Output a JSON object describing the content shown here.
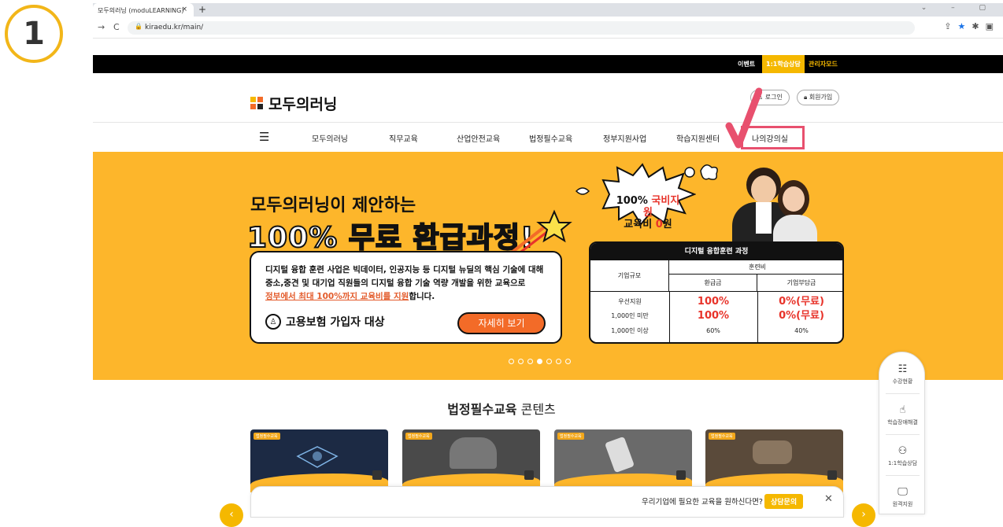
{
  "step_number": "1",
  "browser": {
    "tab_title": "모두의러닝 (moduLEARNING)",
    "tab_close": "×",
    "new_tab": "+",
    "url": "kiraedu.kr/main/",
    "window_controls": "⌄ – ▢",
    "back": "→",
    "reload": "C"
  },
  "topbar": {
    "event": "이벤트",
    "consult": "1:1학습상담",
    "admin": "관리자모드"
  },
  "header": {
    "logo_text": "모두의러닝",
    "login": "로그인",
    "signup": "회원가입"
  },
  "nav": {
    "items": [
      "모두의러닝",
      "직무교육",
      "산업안전교육",
      "법정필수교육",
      "정부지원사업",
      "학습지원센터",
      "나의강의실"
    ]
  },
  "banner": {
    "title1": "모두의러닝이 제안하는",
    "title2": "100% 무료 환급과정!",
    "desc_line1": "디지털 융합 훈련 사업은 빅데이터, 인공지능 등 디지털 뉴딜의 핵심 기술에 대해",
    "desc_line2": "중소,중견 및 대기업 직원들의 디지털 융합 기술 역량 개발을 위한 교육으로",
    "desc_hl": "정부에서 최대 100%까지 교육비를 지원",
    "desc_tail": "합니다.",
    "target": "고용보험 가입자 대상",
    "button": "자세히 보기",
    "burst_line1a": "100% ",
    "burst_line1b": "국비지원",
    "burst_line2a": "교육비 ",
    "burst_line2b": "0",
    "burst_line2c": "원",
    "table": {
      "title": "디지털 융합훈련 과정",
      "col_company": "기업규모",
      "col_fee": "훈련비",
      "col_refund": "환급금",
      "col_burden": "기업부담금",
      "rows": [
        {
          "size": "우선지원",
          "refund": "100%",
          "burden": "0%(무료)"
        },
        {
          "size": "1,000인 미만",
          "refund": "100%",
          "burden": "0%(무료)"
        },
        {
          "size": "1,000인 이상",
          "refund": "60%",
          "burden": "40%"
        }
      ]
    },
    "slide_count": 7,
    "active_slide": 4
  },
  "section": {
    "title_bold": "법정필수교육",
    "title_rest": " 콘텐츠"
  },
  "cards": [
    {
      "tag": "법정필수교육",
      "color": "#1c2a44"
    },
    {
      "tag": "법정필수교육",
      "color": "#4a4a4a"
    },
    {
      "tag": "법정필수교육",
      "color": "#6a6a6a"
    },
    {
      "tag": "법정필수교육",
      "color": "#5a4a3a"
    }
  ],
  "side_menu": [
    "수강현황",
    "학습장애해결",
    "1:1학습상담",
    "원격지원"
  ],
  "bottom_bar": {
    "question": "우리기업에 필요한 교육을 원하신다면?",
    "cta": "상담문의",
    "close": "✕"
  },
  "colors": {
    "accent": "#fdb62b",
    "highlight_box": "#e8506e",
    "button": "#f36b28"
  }
}
